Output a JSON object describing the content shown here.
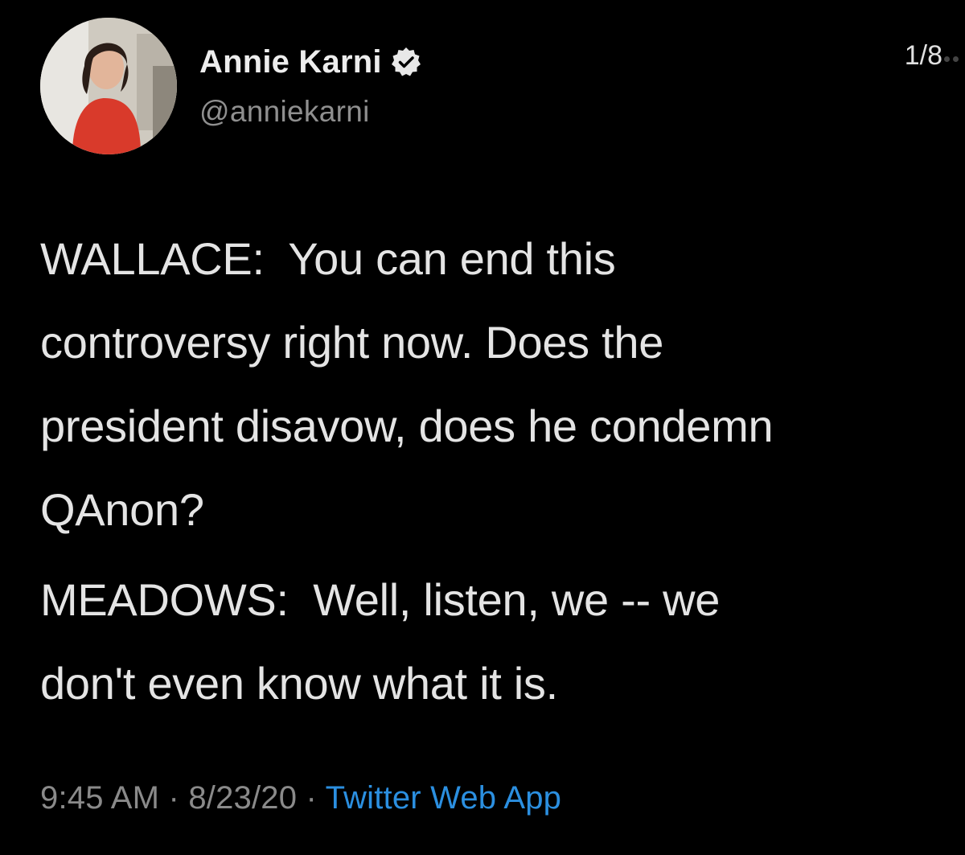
{
  "tweet": {
    "author": {
      "display_name": "Annie Karni",
      "handle": "@anniekarni",
      "verified": true
    },
    "page_counter": "1/8",
    "paragraphs": [
      "WALLACE:  You can end this\ncontroversy right now. Does the\npresident disavow, does he condemn\nQAnon?",
      "MEADOWS:  Well, listen, we -- we\ndon't even know what it is."
    ],
    "meta": {
      "time": "9:45 AM",
      "separator": " · ",
      "date": "8/23/20",
      "source": "Twitter Web App"
    }
  },
  "colors": {
    "background": "#000000",
    "text": "#e4e4e4",
    "muted": "#8a8a8a",
    "link": "#2b8fe0"
  },
  "icons": {
    "verified": "verified-badge-icon"
  }
}
